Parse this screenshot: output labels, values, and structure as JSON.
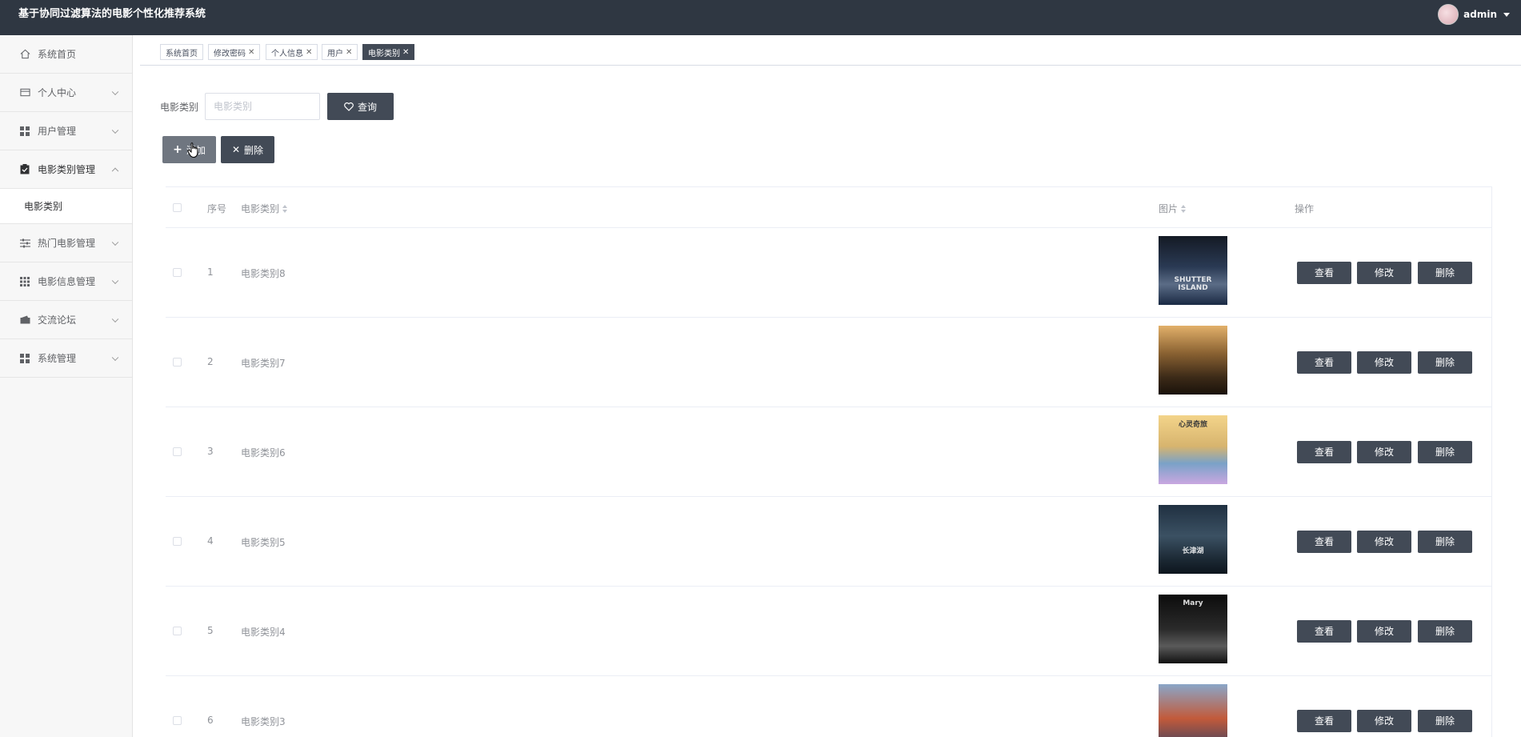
{
  "header": {
    "app_title": "基于协同过滤算法的电影个性化推荐系统",
    "username": "admin"
  },
  "sidebar": {
    "items": [
      {
        "label": "系统首页",
        "icon": "home-icon",
        "has_chevron": false
      },
      {
        "label": "个人中心",
        "icon": "card-icon",
        "has_chevron": true
      },
      {
        "label": "用户管理",
        "icon": "grid-icon",
        "has_chevron": true
      },
      {
        "label": "电影类别管理",
        "icon": "clipboard-icon",
        "has_chevron": true,
        "expanded": true
      },
      {
        "label": "热门电影管理",
        "icon": "sliders-icon",
        "has_chevron": true
      },
      {
        "label": "电影信息管理",
        "icon": "apps-icon",
        "has_chevron": true
      },
      {
        "label": "交流论坛",
        "icon": "wallet-icon",
        "has_chevron": true
      },
      {
        "label": "系统管理",
        "icon": "grid-icon",
        "has_chevron": true
      }
    ],
    "submenu_label": "电影类别"
  },
  "tabs": [
    {
      "label": "系统首页",
      "closable": false
    },
    {
      "label": "修改密码",
      "closable": true
    },
    {
      "label": "个人信息",
      "closable": true
    },
    {
      "label": "用户",
      "closable": true
    },
    {
      "label": "电影类别",
      "closable": true,
      "active": true
    }
  ],
  "search": {
    "label": "电影类别",
    "placeholder": "电影类别",
    "button_label": "查询"
  },
  "toolbar": {
    "add_label": "添加",
    "delete_label": "删除"
  },
  "table": {
    "columns": [
      "序号",
      "电影类别",
      "图片",
      "操作"
    ],
    "action_labels": {
      "view": "查看",
      "edit": "修改",
      "delete": "删除"
    },
    "rows": [
      {
        "index": "1",
        "category": "电影类别8",
        "poster_title": "SHUTTER ISLAND"
      },
      {
        "index": "2",
        "category": "电影类别7",
        "poster_title": ""
      },
      {
        "index": "3",
        "category": "电影类别6",
        "poster_title": "心灵奇旅"
      },
      {
        "index": "4",
        "category": "电影类别5",
        "poster_title": "长津湖"
      },
      {
        "index": "5",
        "category": "电影类别4",
        "poster_title": "Mary"
      },
      {
        "index": "6",
        "category": "电影类别3",
        "poster_title": ""
      }
    ]
  },
  "colors": {
    "header_bg": "#2f3742",
    "button_dark": "#424a56",
    "button_gray": "#6f7680",
    "sidebar_bg": "#f7f7f7"
  }
}
